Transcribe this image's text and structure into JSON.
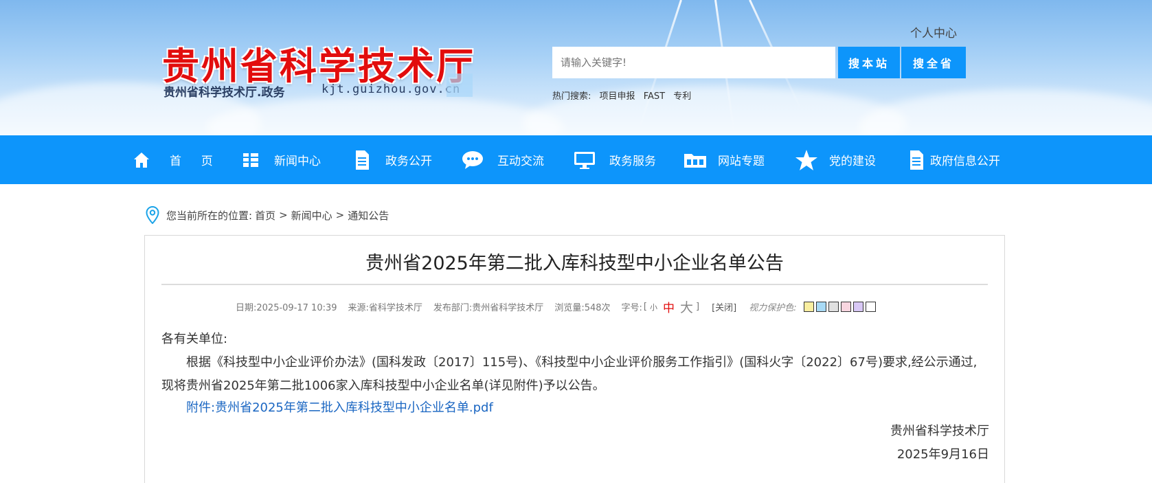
{
  "header": {
    "site_title": "贵州省科学技术厅",
    "site_subtitle": "贵州省科学技术厅.政务",
    "site_domain": "kjt.guizhou.gov.cn",
    "personal_center": "个人中心",
    "search": {
      "placeholder": "请输入关键字!",
      "value": "",
      "btn_site": "搜本站",
      "btn_province": "搜全省"
    },
    "hot_search": {
      "label": "热门搜索:",
      "items": [
        "项目申报",
        "FAST",
        "专利"
      ]
    }
  },
  "nav": {
    "items": [
      {
        "label": "首  页",
        "icon": "home-icon"
      },
      {
        "label": "新闻中心",
        "icon": "news-grid-icon"
      },
      {
        "label": "政务公开",
        "icon": "document-icon"
      },
      {
        "label": "互动交流",
        "icon": "chat-icon"
      },
      {
        "label": "政务服务",
        "icon": "monitor-icon"
      },
      {
        "label": "网站专题",
        "icon": "folder-icon"
      },
      {
        "label": "党的建设",
        "icon": "star-icon"
      },
      {
        "label": "政府信息公开",
        "icon": "document-icon"
      }
    ]
  },
  "breadcrumb": {
    "prefix": "您当前所在的位置:",
    "items": [
      "首页",
      "新闻中心",
      "通知公告"
    ],
    "separator": ">"
  },
  "article": {
    "title": "贵州省2025年第二批入库科技型中小企业名单公告",
    "meta": {
      "date": "日期:2025-09-17 10:39",
      "source": "来源:省科学技术厅",
      "department": "发布部门:贵州省科学技术厅",
      "views": "浏览量:548次",
      "font_size_label": "字号:",
      "font_small": "小",
      "font_medium": "中",
      "font_large": "大",
      "close": "[关闭]",
      "eye_protect": "视力保护色:",
      "swatch_colors": [
        "#f9eea0",
        "#a8daf5",
        "#e0e0e0",
        "#f9d6e0",
        "#d8c8f5",
        "#ffffff"
      ]
    },
    "greeting": "各有关单位:",
    "body": "根据《科技型中小企业评价办法》(国科发政〔2017〕115号)、《科技型中小企业评价服务工作指引》(国科火字〔2022〕67号)要求,经公示通过,现将贵州省2025年第二批1006家入库科技型中小企业名单(详见附件)予以公告。",
    "attachment": "附件:贵州省2025年第二批入库科技型中小企业名单.pdf",
    "signature": "贵州省科学技术厅",
    "sign_date": "2025年9月16日"
  },
  "colors": {
    "brand_blue": "#0d95fb",
    "title_red": "#e20d0d",
    "link_blue": "#1a66c2"
  }
}
